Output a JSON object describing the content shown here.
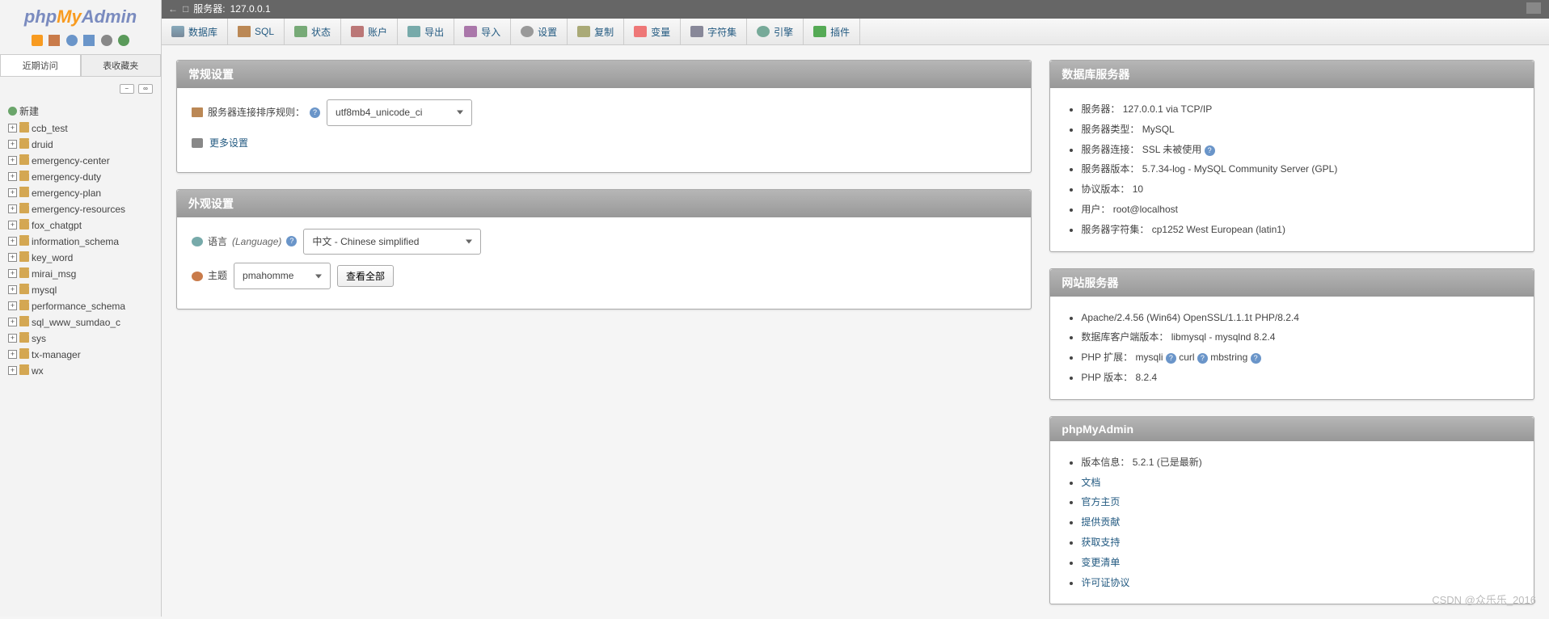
{
  "logo": {
    "php": "php",
    "my": "My",
    "admin": "Admin"
  },
  "sidebar_tabs": {
    "recent": "近期访问",
    "favorites": "表收藏夹"
  },
  "nav_toggles": {
    "minus": "−",
    "link": "∞"
  },
  "tree": {
    "new_label": "新建",
    "databases": [
      "ccb_test",
      "druid",
      "emergency-center",
      "emergency-duty",
      "emergency-plan",
      "emergency-resources",
      "fox_chatgpt",
      "information_schema",
      "key_word",
      "mirai_msg",
      "mysql",
      "performance_schema",
      "sql_www_sumdao_c",
      "sys",
      "tx-manager",
      "wx"
    ]
  },
  "topbar": {
    "arrow": "←",
    "server_icon": "□",
    "label": "服务器:",
    "value": "127.0.0.1"
  },
  "topmenu": [
    {
      "label": "数据库",
      "icon": "tm-db"
    },
    {
      "label": "SQL",
      "icon": "tm-sql"
    },
    {
      "label": "状态",
      "icon": "tm-status"
    },
    {
      "label": "账户",
      "icon": "tm-users"
    },
    {
      "label": "导出",
      "icon": "tm-export"
    },
    {
      "label": "导入",
      "icon": "tm-import"
    },
    {
      "label": "设置",
      "icon": "tm-settings"
    },
    {
      "label": "复制",
      "icon": "tm-replication"
    },
    {
      "label": "变量",
      "icon": "tm-variables"
    },
    {
      "label": "字符集",
      "icon": "tm-charset"
    },
    {
      "label": "引擎",
      "icon": "tm-engines"
    },
    {
      "label": "插件",
      "icon": "tm-plugins"
    }
  ],
  "general_settings": {
    "title": "常规设置",
    "collation_label": "服务器连接排序规则：",
    "collation_value": "utf8mb4_unicode_ci",
    "more_settings": "更多设置"
  },
  "appearance": {
    "title": "外观设置",
    "lang_label": "语言",
    "lang_hint": "(Language)",
    "lang_value": "中文 - Chinese simplified",
    "theme_label": "主题",
    "theme_value": "pmahomme",
    "view_all": "查看全部"
  },
  "dbserver": {
    "title": "数据库服务器",
    "rows": [
      "服务器： 127.0.0.1 via TCP/IP",
      "服务器类型： MySQL",
      "服务器连接： SSL 未被使用",
      "服务器版本： 5.7.34-log - MySQL Community Server (GPL)",
      "协议版本： 10",
      "用户： root@localhost",
      "服务器字符集： cp1252 West European (latin1)"
    ],
    "ssl_help_index": 2
  },
  "webserver": {
    "title": "网站服务器",
    "line0": "Apache/2.4.56 (Win64) OpenSSL/1.1.1t PHP/8.2.4",
    "line1": "数据库客户端版本： libmysql - mysqlnd 8.2.4",
    "php_ext_label": "PHP 扩展：",
    "php_ext": [
      "mysqli",
      "curl",
      "mbstring"
    ],
    "php_ver": "PHP 版本： 8.2.4"
  },
  "pma": {
    "title": "phpMyAdmin",
    "version": "版本信息： 5.2.1 (已是最新)",
    "links": [
      "文档",
      "官方主页",
      "提供贡献",
      "获取支持",
      "变更清单",
      "许可证协议"
    ]
  },
  "watermark": "CSDN @众乐乐_2016"
}
